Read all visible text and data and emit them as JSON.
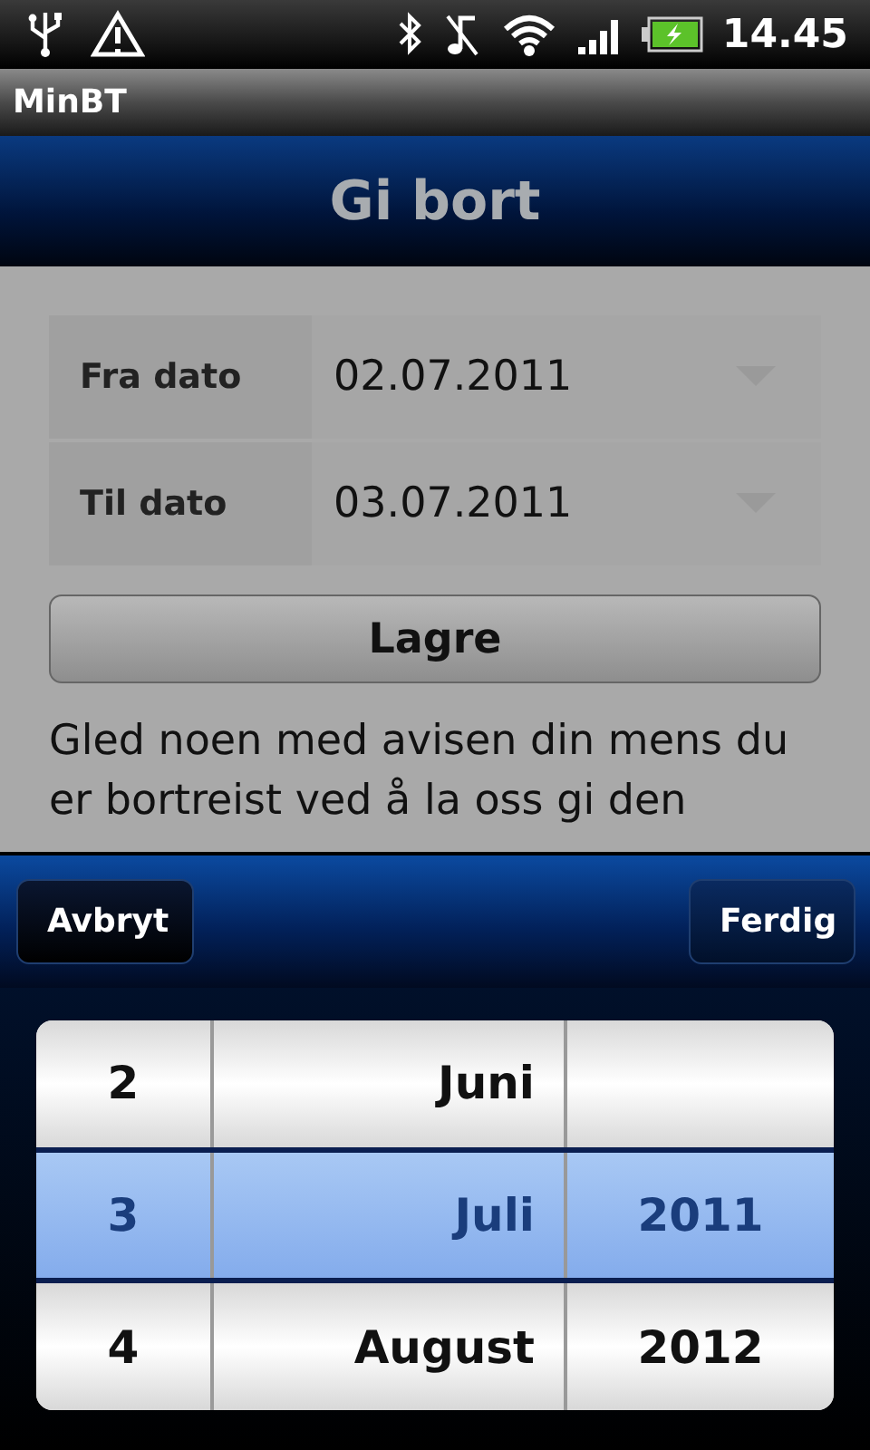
{
  "status_bar": {
    "time": "14.45"
  },
  "app_title": "MinBT",
  "header": {
    "title": "Gi bort"
  },
  "form": {
    "rows": [
      {
        "label": "Fra dato",
        "value": "02.07.2011"
      },
      {
        "label": "Til dato",
        "value": "03.07.2011"
      }
    ],
    "save_button": "Lagre",
    "description": "Gled noen med avisen din mens du er bortreist ved å la oss gi den"
  },
  "picker_toolbar": {
    "cancel": "Avbryt",
    "done": "Ferdig"
  },
  "picker": {
    "rows": [
      {
        "day": "2",
        "month": "Juni",
        "selected": false
      },
      {
        "day": "3",
        "month": "Juli",
        "year": "2011",
        "selected": true
      },
      {
        "day": "4",
        "month": "August",
        "year": "2012",
        "selected": false
      }
    ]
  }
}
